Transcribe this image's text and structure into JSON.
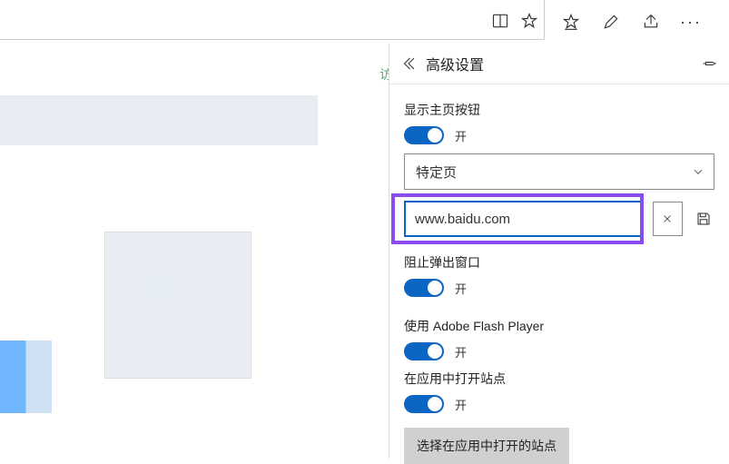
{
  "panel": {
    "title": "高级设置",
    "home_button": {
      "label": "显示主页按钮",
      "toggle_text": "开"
    },
    "page_select": {
      "value": "特定页"
    },
    "url_input": {
      "value": "www.baidu.com"
    },
    "block_popups": {
      "label": "阻止弹出窗口",
      "toggle_text": "开"
    },
    "flash": {
      "label": "使用 Adobe Flash Player",
      "toggle_text": "开"
    },
    "open_in_app": {
      "label": "在应用中打开站点",
      "toggle_text": "开"
    },
    "choose_sites_button": "选择在应用中打开的站点"
  }
}
